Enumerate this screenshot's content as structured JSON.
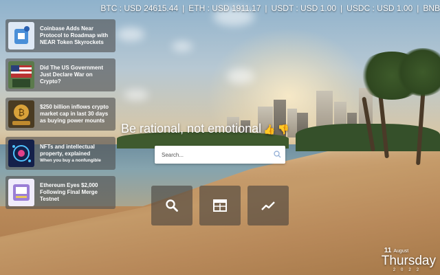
{
  "ticker": [
    {
      "symbol": "BTC",
      "text": "BTC : USD 24615.44"
    },
    {
      "symbol": "ETH",
      "text": "ETH : USD 1911.17"
    },
    {
      "symbol": "USDT",
      "text": "USDT : USD 1.00"
    },
    {
      "symbol": "USDC",
      "text": "USDC : USD 1.00"
    },
    {
      "symbol": "BNB",
      "text": "BNB"
    }
  ],
  "ticker_separator": "|",
  "news": [
    {
      "title": "Coinbase Adds Near Protocol to Roadmap with NEAR Token Skyrockets",
      "subtitle": "",
      "thumb_color": "#4a8fd8"
    },
    {
      "title": "Did The US Government Just Declare War on Crypto?",
      "subtitle": "",
      "thumb_color": "#3d6a3a"
    },
    {
      "title": "$250 billion inflows crypto market cap in last 30 days as buying power mounts",
      "subtitle": "",
      "thumb_color": "#c89a3c"
    },
    {
      "title": "NFTs and intellectual property, explained",
      "subtitle": "When you buy a nonfungible",
      "thumb_color": "#1d3d8a"
    },
    {
      "title": "Ethereum Eyes $2,000 Following Final Merge Testnet",
      "subtitle": "",
      "thumb_color": "#9b7fd6"
    }
  ],
  "headline": {
    "text": "Be rational, not emotional",
    "emoji_up": "👍",
    "emoji_down": "👎"
  },
  "search": {
    "placeholder": "Search..."
  },
  "actions": [
    {
      "name": "search",
      "icon": "search-icon"
    },
    {
      "name": "news",
      "icon": "newspaper-icon"
    },
    {
      "name": "chart",
      "icon": "trend-chart-icon"
    }
  ],
  "date": {
    "day": "11",
    "month": "August",
    "weekday": "Thursday",
    "year": "2022"
  }
}
